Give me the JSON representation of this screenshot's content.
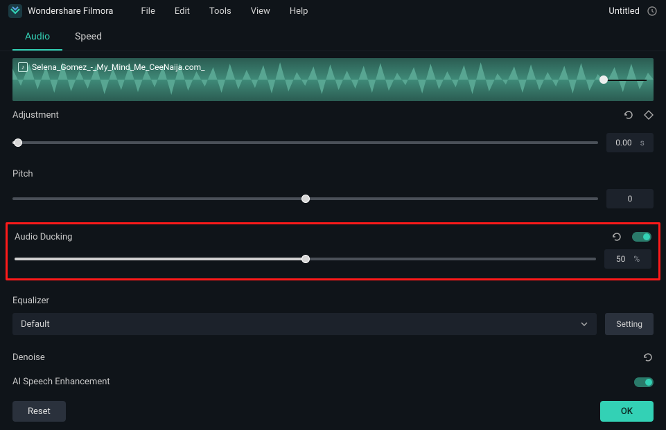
{
  "titlebar": {
    "app_name": "Wondershare Filmora",
    "menu": [
      "File",
      "Edit",
      "Tools",
      "View",
      "Help"
    ],
    "doc_title": "Untitled"
  },
  "tabs": {
    "audio": "Audio",
    "speed": "Speed"
  },
  "clip": {
    "filename": "Selena_Gomez_-_My_Mind_Me_CeeNaija.com_"
  },
  "adjustment": {
    "label": "Adjustment",
    "value": "0.00",
    "unit": "s",
    "pos_pct": 1
  },
  "pitch": {
    "label": "Pitch",
    "value": "0",
    "pos_pct": 50
  },
  "ducking": {
    "label": "Audio Ducking",
    "value": "50",
    "unit": "%",
    "pos_pct": 50
  },
  "equalizer": {
    "label": "Equalizer",
    "selected": "Default",
    "setting_btn": "Setting"
  },
  "denoise": {
    "label": "Denoise"
  },
  "speech": {
    "label": "AI Speech Enhancement"
  },
  "footer": {
    "reset": "Reset",
    "ok": "OK"
  }
}
